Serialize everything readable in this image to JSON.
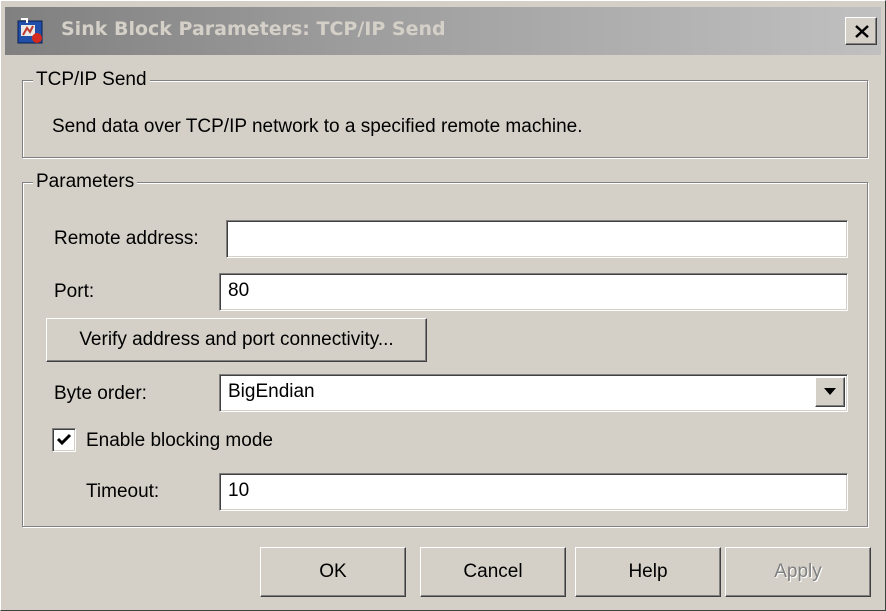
{
  "window": {
    "title": "Sink Block Parameters: TCP/IP Send"
  },
  "description_group": {
    "legend": "TCP/IP Send",
    "text": "Send data over TCP/IP network to a specified remote machine."
  },
  "parameters": {
    "legend": "Parameters",
    "remote_address": {
      "label": "Remote address:",
      "value": ""
    },
    "port": {
      "label": "Port:",
      "value": "80"
    },
    "verify_button": "Verify address and port connectivity...",
    "byte_order": {
      "label": "Byte order:",
      "value": "BigEndian"
    },
    "blocking_mode": {
      "label": "Enable blocking mode",
      "checked": true
    },
    "timeout": {
      "label": "Timeout:",
      "value": "10"
    }
  },
  "buttons": {
    "ok": "OK",
    "cancel": "Cancel",
    "help": "Help",
    "apply": "Apply"
  },
  "icons": [
    "simulink-block-icon",
    "close-icon",
    "chevron-down-icon",
    "checkmark-icon"
  ]
}
